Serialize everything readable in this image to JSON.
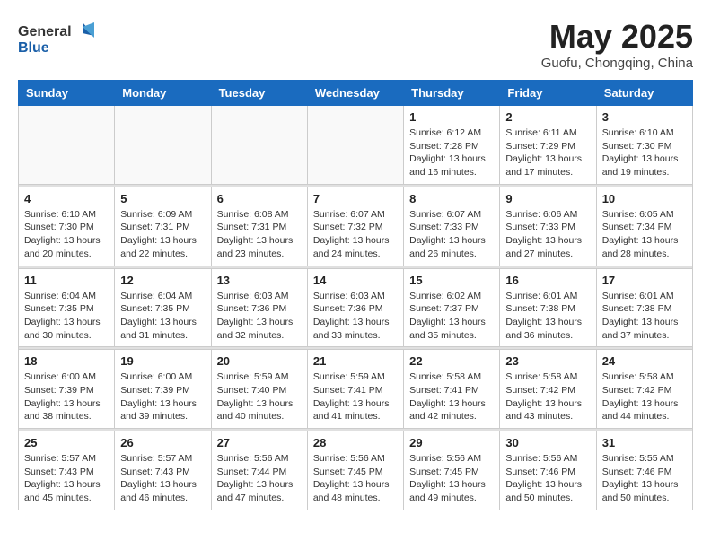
{
  "header": {
    "logo_general": "General",
    "logo_blue": "Blue",
    "title": "May 2025",
    "subtitle": "Guofu, Chongqing, China"
  },
  "weekdays": [
    "Sunday",
    "Monday",
    "Tuesday",
    "Wednesday",
    "Thursday",
    "Friday",
    "Saturday"
  ],
  "weeks": [
    [
      {
        "day": "",
        "info": ""
      },
      {
        "day": "",
        "info": ""
      },
      {
        "day": "",
        "info": ""
      },
      {
        "day": "",
        "info": ""
      },
      {
        "day": "1",
        "info": "Sunrise: 6:12 AM\nSunset: 7:28 PM\nDaylight: 13 hours and 16 minutes."
      },
      {
        "day": "2",
        "info": "Sunrise: 6:11 AM\nSunset: 7:29 PM\nDaylight: 13 hours and 17 minutes."
      },
      {
        "day": "3",
        "info": "Sunrise: 6:10 AM\nSunset: 7:30 PM\nDaylight: 13 hours and 19 minutes."
      }
    ],
    [
      {
        "day": "4",
        "info": "Sunrise: 6:10 AM\nSunset: 7:30 PM\nDaylight: 13 hours and 20 minutes."
      },
      {
        "day": "5",
        "info": "Sunrise: 6:09 AM\nSunset: 7:31 PM\nDaylight: 13 hours and 22 minutes."
      },
      {
        "day": "6",
        "info": "Sunrise: 6:08 AM\nSunset: 7:31 PM\nDaylight: 13 hours and 23 minutes."
      },
      {
        "day": "7",
        "info": "Sunrise: 6:07 AM\nSunset: 7:32 PM\nDaylight: 13 hours and 24 minutes."
      },
      {
        "day": "8",
        "info": "Sunrise: 6:07 AM\nSunset: 7:33 PM\nDaylight: 13 hours and 26 minutes."
      },
      {
        "day": "9",
        "info": "Sunrise: 6:06 AM\nSunset: 7:33 PM\nDaylight: 13 hours and 27 minutes."
      },
      {
        "day": "10",
        "info": "Sunrise: 6:05 AM\nSunset: 7:34 PM\nDaylight: 13 hours and 28 minutes."
      }
    ],
    [
      {
        "day": "11",
        "info": "Sunrise: 6:04 AM\nSunset: 7:35 PM\nDaylight: 13 hours and 30 minutes."
      },
      {
        "day": "12",
        "info": "Sunrise: 6:04 AM\nSunset: 7:35 PM\nDaylight: 13 hours and 31 minutes."
      },
      {
        "day": "13",
        "info": "Sunrise: 6:03 AM\nSunset: 7:36 PM\nDaylight: 13 hours and 32 minutes."
      },
      {
        "day": "14",
        "info": "Sunrise: 6:03 AM\nSunset: 7:36 PM\nDaylight: 13 hours and 33 minutes."
      },
      {
        "day": "15",
        "info": "Sunrise: 6:02 AM\nSunset: 7:37 PM\nDaylight: 13 hours and 35 minutes."
      },
      {
        "day": "16",
        "info": "Sunrise: 6:01 AM\nSunset: 7:38 PM\nDaylight: 13 hours and 36 minutes."
      },
      {
        "day": "17",
        "info": "Sunrise: 6:01 AM\nSunset: 7:38 PM\nDaylight: 13 hours and 37 minutes."
      }
    ],
    [
      {
        "day": "18",
        "info": "Sunrise: 6:00 AM\nSunset: 7:39 PM\nDaylight: 13 hours and 38 minutes."
      },
      {
        "day": "19",
        "info": "Sunrise: 6:00 AM\nSunset: 7:39 PM\nDaylight: 13 hours and 39 minutes."
      },
      {
        "day": "20",
        "info": "Sunrise: 5:59 AM\nSunset: 7:40 PM\nDaylight: 13 hours and 40 minutes."
      },
      {
        "day": "21",
        "info": "Sunrise: 5:59 AM\nSunset: 7:41 PM\nDaylight: 13 hours and 41 minutes."
      },
      {
        "day": "22",
        "info": "Sunrise: 5:58 AM\nSunset: 7:41 PM\nDaylight: 13 hours and 42 minutes."
      },
      {
        "day": "23",
        "info": "Sunrise: 5:58 AM\nSunset: 7:42 PM\nDaylight: 13 hours and 43 minutes."
      },
      {
        "day": "24",
        "info": "Sunrise: 5:58 AM\nSunset: 7:42 PM\nDaylight: 13 hours and 44 minutes."
      }
    ],
    [
      {
        "day": "25",
        "info": "Sunrise: 5:57 AM\nSunset: 7:43 PM\nDaylight: 13 hours and 45 minutes."
      },
      {
        "day": "26",
        "info": "Sunrise: 5:57 AM\nSunset: 7:43 PM\nDaylight: 13 hours and 46 minutes."
      },
      {
        "day": "27",
        "info": "Sunrise: 5:56 AM\nSunset: 7:44 PM\nDaylight: 13 hours and 47 minutes."
      },
      {
        "day": "28",
        "info": "Sunrise: 5:56 AM\nSunset: 7:45 PM\nDaylight: 13 hours and 48 minutes."
      },
      {
        "day": "29",
        "info": "Sunrise: 5:56 AM\nSunset: 7:45 PM\nDaylight: 13 hours and 49 minutes."
      },
      {
        "day": "30",
        "info": "Sunrise: 5:56 AM\nSunset: 7:46 PM\nDaylight: 13 hours and 50 minutes."
      },
      {
        "day": "31",
        "info": "Sunrise: 5:55 AM\nSunset: 7:46 PM\nDaylight: 13 hours and 50 minutes."
      }
    ]
  ]
}
